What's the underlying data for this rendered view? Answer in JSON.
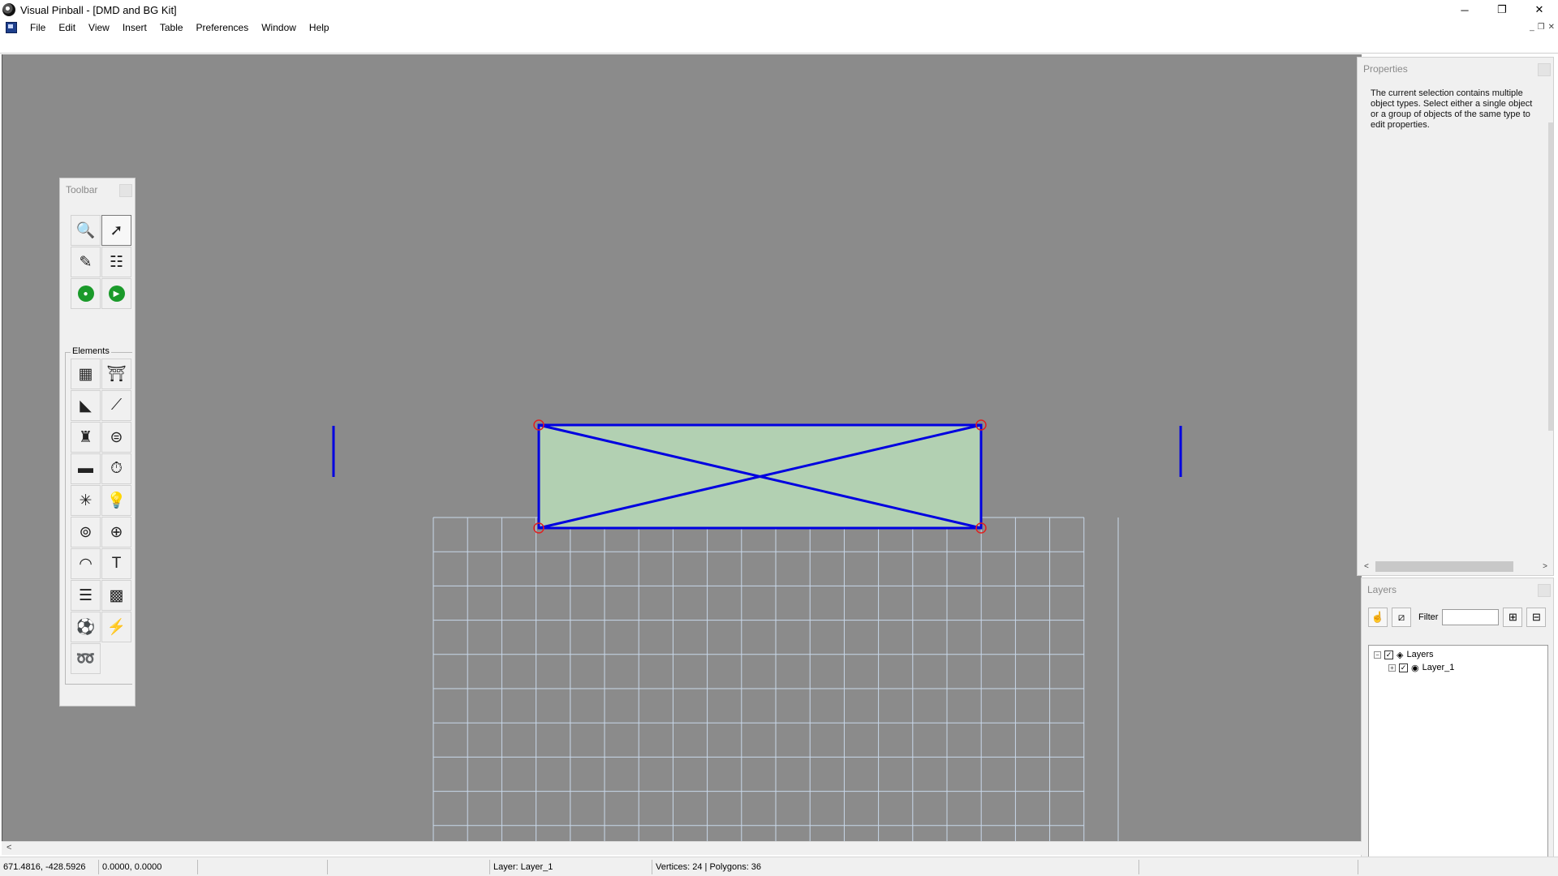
{
  "window": {
    "title": "Visual Pinball - [DMD and BG Kit]",
    "controls": {
      "minimize": "─",
      "restore": "❐",
      "close": "✕"
    }
  },
  "menu": {
    "items": [
      "File",
      "Edit",
      "View",
      "Insert",
      "Table",
      "Preferences",
      "Window",
      "Help"
    ],
    "mdi_controls": {
      "minimize": "_",
      "restore": "❐",
      "close": "✕"
    }
  },
  "toolbar": {
    "title": "Toolbar",
    "tools": [
      {
        "name": "magnify-icon",
        "glyph": "🔍"
      },
      {
        "name": "select-arrow-icon",
        "glyph": "➚",
        "selected": true
      },
      {
        "name": "options-icon",
        "glyph": "✎"
      },
      {
        "name": "backglass-icon",
        "glyph": "☷"
      },
      {
        "name": "camera-icon",
        "glyph": "●"
      },
      {
        "name": "play-icon",
        "glyph": "▶"
      }
    ],
    "elements_label": "Elements",
    "elements": [
      "wall-icon",
      "gate-icon",
      "ramp-icon",
      "flipper-icon",
      "plunger-icon",
      "bumper-icon",
      "spinner-icon",
      "timer-icon",
      "trigger-icon",
      "light-icon",
      "kicker-icon",
      "target-icon",
      "decal-icon",
      "textbox-icon",
      "reel-icon",
      "lightseq-icon",
      "primitive-icon",
      "flasher-icon",
      "rubber-icon"
    ],
    "element_glyphs": [
      "▦",
      "⛩",
      "◣",
      "⟋",
      "♜",
      "⊜",
      "▬",
      "⏱",
      "✳",
      "💡",
      "⊚",
      "⊕",
      "◠",
      "T",
      "☰",
      "▩",
      "⚽",
      "⚡",
      "➿"
    ]
  },
  "properties": {
    "title": "Properties",
    "message": "The current selection contains multiple object types. Select either a single object or a group of objects of the same type to edit properties.",
    "scroll_left": "<",
    "scroll_right": ">"
  },
  "layers": {
    "title": "Layers",
    "filter_label": "Filter",
    "filter_value": "",
    "add_glyph": "⊞",
    "remove_glyph": "⊟",
    "tree": [
      {
        "label": "Layers",
        "expander": "−",
        "checked": "✓",
        "icon": "◈"
      },
      {
        "label": "Layer_1",
        "expander": "+",
        "checked": "✓",
        "icon": "◉"
      }
    ]
  },
  "scroll": {
    "left_arrow": "<"
  },
  "status": {
    "coords": "671.4816, -428.5926",
    "offset": "0.0000, 0.0000",
    "empty1": "",
    "empty2": "",
    "layer": "Layer: Layer_1",
    "stats": "Vertices: 24 | Polygons: 36",
    "empty3": ""
  },
  "colors": {
    "workspace": "#8b8b8b",
    "selection_outline": "#0000e0",
    "selection_fill": "#b2d0b2",
    "grid_lines": "#c8d8ea",
    "handle": "#e02020"
  }
}
